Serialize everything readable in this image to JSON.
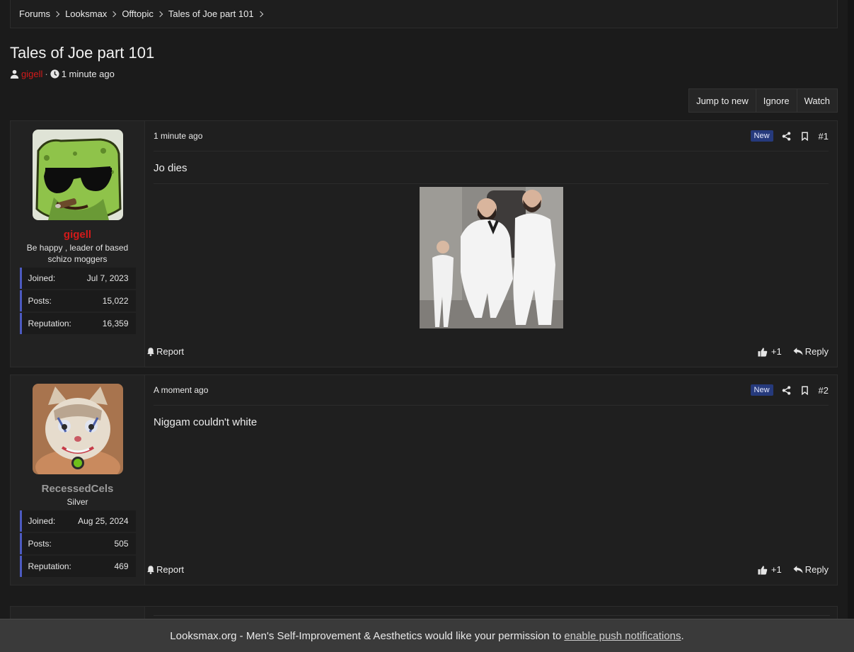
{
  "breadcrumb": [
    "Forums",
    "Looksmax",
    "Offtopic",
    "Tales of Joe part 101"
  ],
  "thread": {
    "title": "Tales of Joe part 101",
    "author": "gigell",
    "time": "1 minute ago",
    "actions": [
      "Jump to new",
      "Ignore",
      "Watch"
    ]
  },
  "posts": [
    {
      "username": "gigell",
      "username_color": "#d31a1a",
      "user_title": "Be happy , leader of based schizo moggers",
      "stats": [
        {
          "label": "Joined:",
          "value": "Jul 7, 2023"
        },
        {
          "label": "Posts:",
          "value": "15,022"
        },
        {
          "label": "Reputation:",
          "value": "16,359"
        }
      ],
      "time": "1 minute ago",
      "badge": "New",
      "number": "#1",
      "body": "Jo dies",
      "report": "Report",
      "likes": "+1",
      "reply": "Reply"
    },
    {
      "username": "RecessedCels",
      "username_color": "#9a9a9a",
      "user_title": "Silver",
      "stats": [
        {
          "label": "Joined:",
          "value": "Aug 25, 2024"
        },
        {
          "label": "Posts:",
          "value": "505"
        },
        {
          "label": "Reputation:",
          "value": "469"
        }
      ],
      "time": "A moment ago",
      "badge": "New",
      "number": "#2",
      "body": "Niggam couldn't white",
      "report": "Report",
      "likes": "+1",
      "reply": "Reply"
    }
  ],
  "notice": {
    "text": "Looksmax.org - Men's Self-Improvement & Aesthetics would like your permission to",
    "link": "enable push notifications",
    "end": "."
  },
  "colors": {
    "accent_stat_border": "#4c5ac0",
    "badge_new": "#263a7c",
    "online": "#6ec01a"
  }
}
